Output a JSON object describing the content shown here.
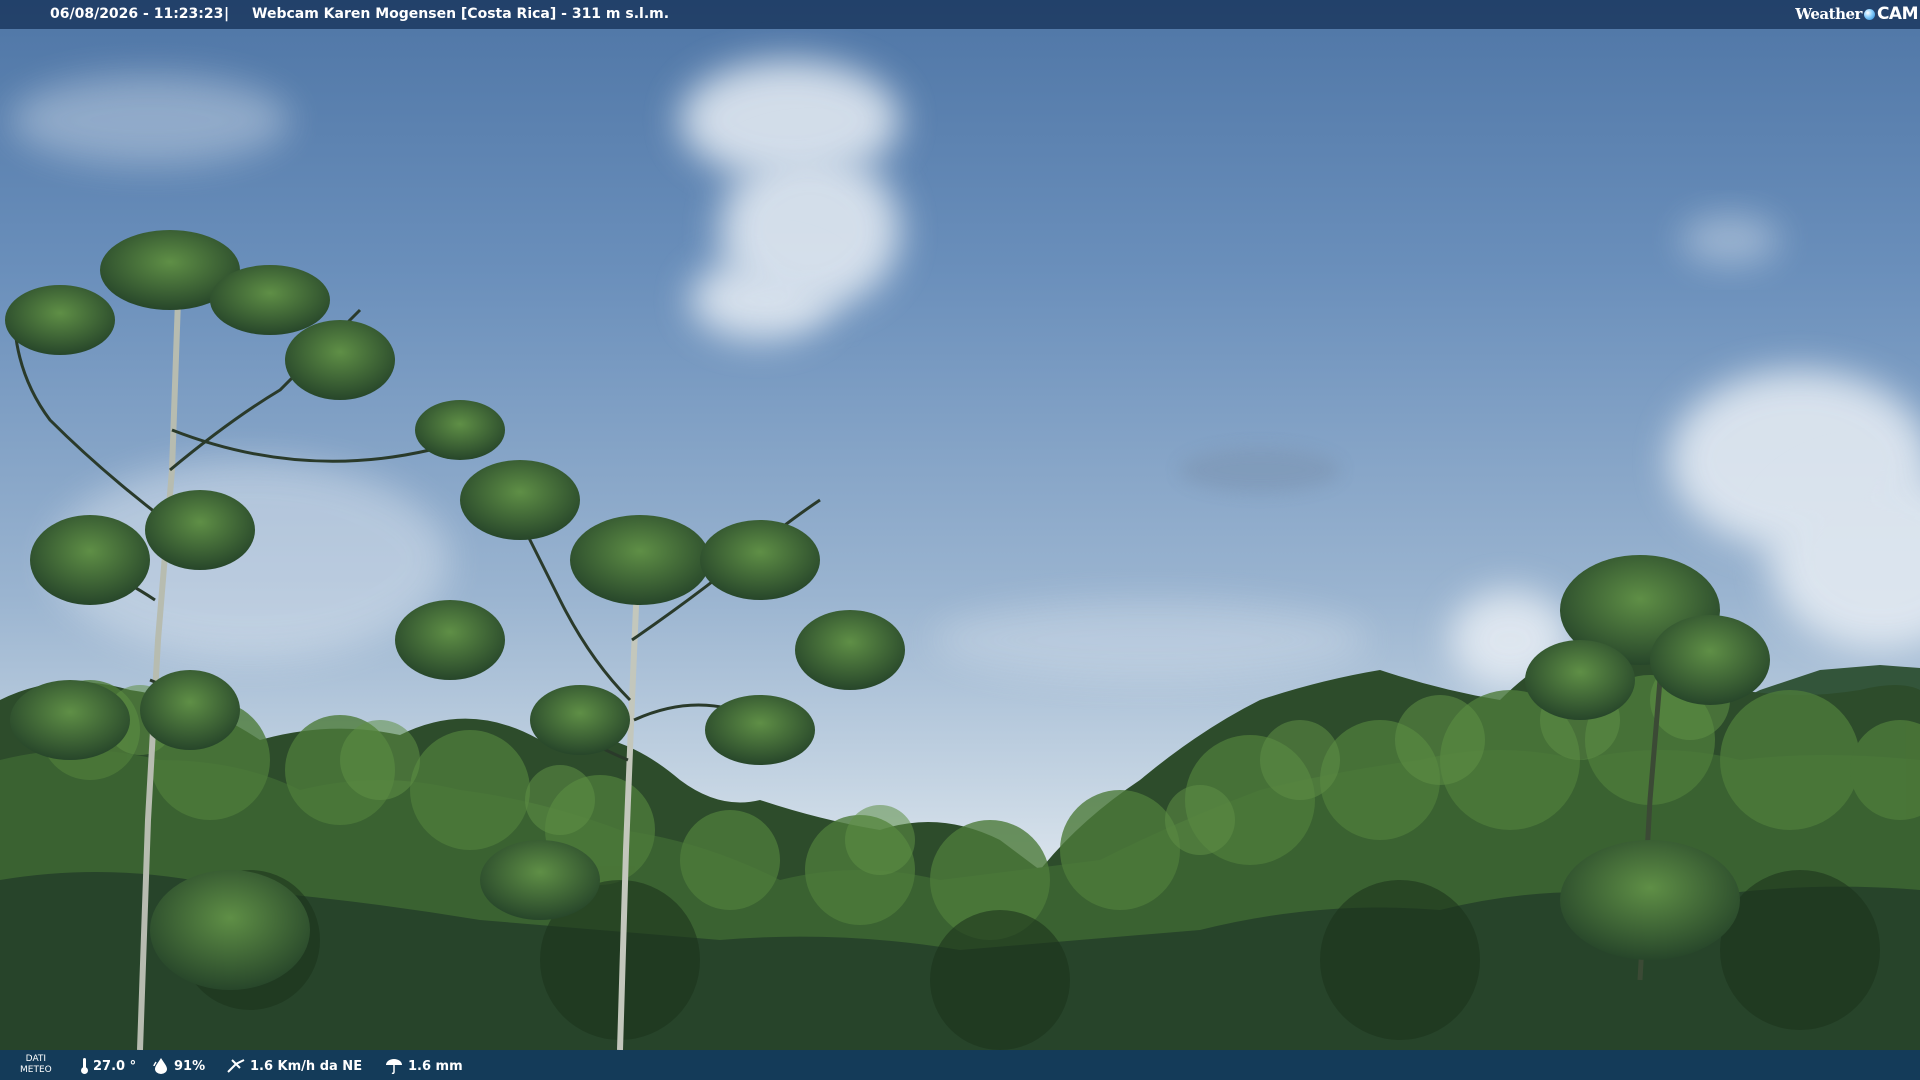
{
  "header": {
    "timestamp": "06/08/2026 - 11:23:23",
    "separator": "|",
    "title": "Webcam Karen Mogensen [Costa Rica] - 311 m s.l.m."
  },
  "brand": {
    "word": "Weather",
    "cam": "CAM"
  },
  "footer": {
    "dati_line1": "DATI",
    "dati_line2": "METEO",
    "temperature": "27.0 °",
    "humidity": "91%",
    "wind": "1.6 Km/h da NE",
    "rain": "1.6 mm"
  },
  "icons": [
    "thermometer-icon",
    "humidity-icon",
    "wind-icon",
    "rain-icon",
    "weathercam-logo-icon"
  ],
  "colors": {
    "bar": "#1c3a62",
    "sky_top": "#4f76a6",
    "sky_low": "#d9e3ec",
    "foliage_dark": "#1f3a1f",
    "foliage_mid": "#3e6a30"
  }
}
